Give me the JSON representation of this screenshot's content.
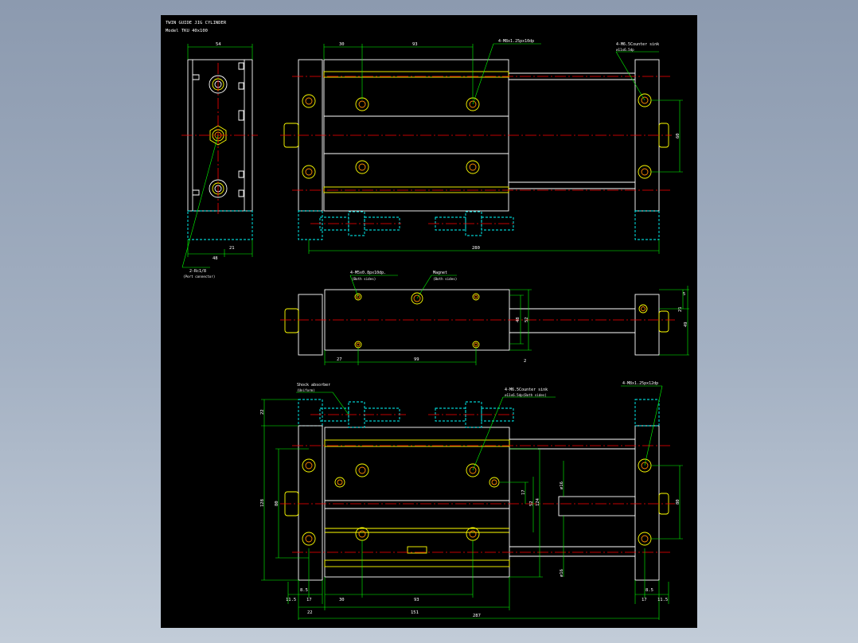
{
  "title": {
    "line1": "TWIN GUIDE JIG CYLINDER",
    "line2": "Model TKU 40x100"
  },
  "top_left": {
    "dim_width": "54",
    "dim_48": "48",
    "dim_21": "21",
    "callout": "2-Rc1/8",
    "callout_note": "(Port connector)"
  },
  "top_right": {
    "dim_30": "30",
    "dim_93": "93",
    "callout_tap": "4-M8x1.25px10dp",
    "callout_screw": "4-M6.5Counter sink",
    "callout_screw_note": "⌀11x6.5dp",
    "dim_60": "60",
    "dim_280": "280"
  },
  "middle": {
    "callout_tap": "4-M5x0.8px10dp.",
    "callout_tap_note": "(Both sides)",
    "callout_magnet": "Magnet",
    "callout_magnet_note": "(Both sides)",
    "dim_27": "27",
    "dim_99": "99",
    "dim_48": "48",
    "dim_52": "52",
    "dim_21": "21",
    "dim_49": "49",
    "dim_5": "5",
    "dim_2": "2"
  },
  "bottom": {
    "callout_shock": "Shock absorber",
    "callout_shock_note": "(Uniform)",
    "callout_screw": "4-M6.5Counter sink",
    "callout_screw_note": "⌀11x6.5dp(Both sides)",
    "callout_tap": "4-M8x1.25px12dp",
    "dim_22_top": "22",
    "dim_128": "128",
    "dim_80_left": "80",
    "dim_17": "17",
    "dim_52": "52",
    "dim_124": "124",
    "dim_phi16_top": "⌀16",
    "dim_phi16_bottom": "⌀16",
    "dim_80_right": "80",
    "dim_11_5_left": "11.5",
    "dim_17_left": "17",
    "dim_8_5_left": "8.5",
    "dim_22_bottom": "22",
    "dim_30": "30",
    "dim_93": "93",
    "dim_151": "151",
    "dim_8_5_right": "8.5",
    "dim_17_right": "17",
    "dim_11_5_right": "11.5",
    "dim_287": "287"
  }
}
